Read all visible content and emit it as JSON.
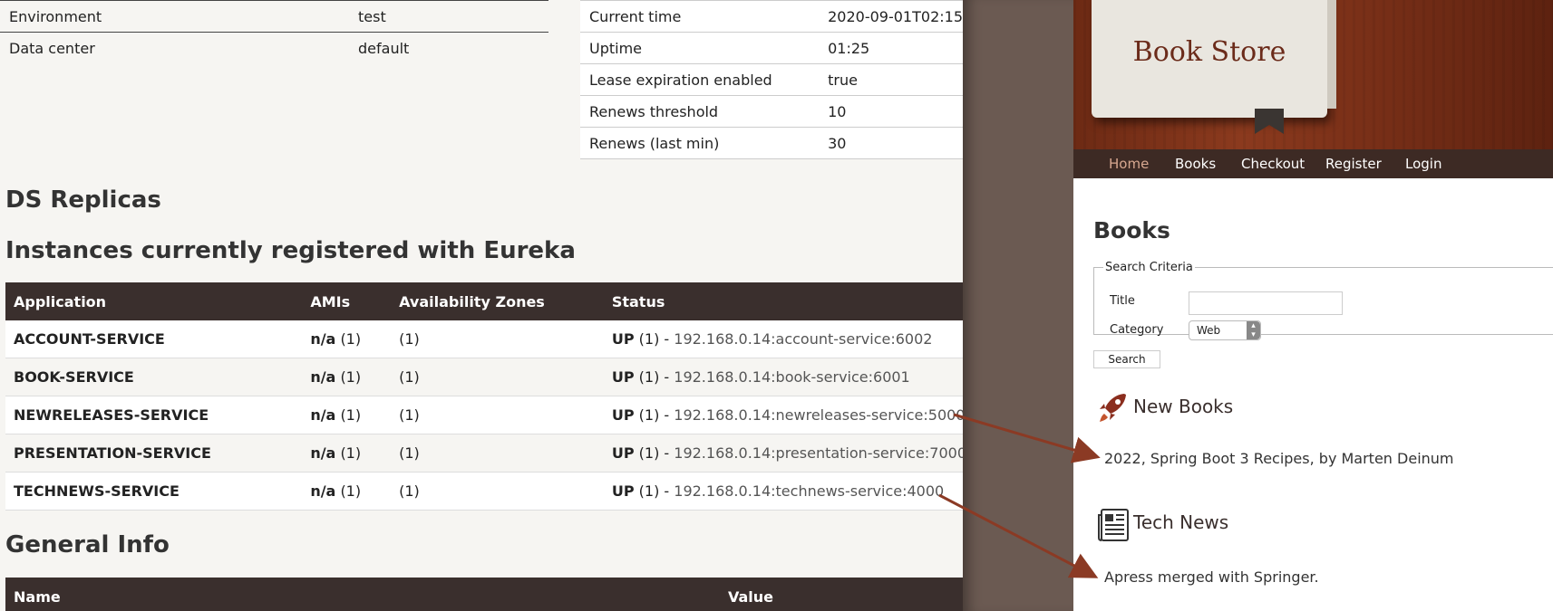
{
  "eureka": {
    "env_rows": [
      {
        "key": "Environment",
        "value": "test"
      },
      {
        "key": "Data center",
        "value": "default"
      }
    ],
    "status_rows": [
      {
        "key": "Current time",
        "value": "2020-09-01T02:15"
      },
      {
        "key": "Uptime",
        "value": "01:25"
      },
      {
        "key": "Lease expiration enabled",
        "value": "true"
      },
      {
        "key": "Renews threshold",
        "value": "10"
      },
      {
        "key": "Renews (last min)",
        "value": "30"
      }
    ],
    "ds_replicas_heading": "DS Replicas",
    "instances_heading": "Instances currently registered with Eureka",
    "instances_columns": [
      "Application",
      "AMIs",
      "Availability Zones",
      "Status"
    ],
    "instances": [
      {
        "app": "ACCOUNT-SERVICE",
        "ami_label": "n/a",
        "ami_count": "(1)",
        "zones": "(1)",
        "status": "UP",
        "status_count": "(1) -",
        "url": "192.168.0.14:account-service:6002"
      },
      {
        "app": "BOOK-SERVICE",
        "ami_label": "n/a",
        "ami_count": "(1)",
        "zones": "(1)",
        "status": "UP",
        "status_count": "(1) -",
        "url": "192.168.0.14:book-service:6001"
      },
      {
        "app": "NEWRELEASES-SERVICE",
        "ami_label": "n/a",
        "ami_count": "(1)",
        "zones": "(1)",
        "status": "UP",
        "status_count": "(1) -",
        "url": "192.168.0.14:newreleases-service:5000"
      },
      {
        "app": "PRESENTATION-SERVICE",
        "ami_label": "n/a",
        "ami_count": "(1)",
        "zones": "(1)",
        "status": "UP",
        "status_count": "(1) -",
        "url": "192.168.0.14:presentation-service:7000"
      },
      {
        "app": "TECHNEWS-SERVICE",
        "ami_label": "n/a",
        "ami_count": "(1)",
        "zones": "(1)",
        "status": "UP",
        "status_count": "(1) -",
        "url": "192.168.0.14:technews-service:4000"
      }
    ],
    "general_info_heading": "General Info",
    "general_info_columns": [
      "Name",
      "Value"
    ]
  },
  "store": {
    "banner_title": "Book Store",
    "nav": [
      "Home",
      "Books",
      "Checkout",
      "Register",
      "Login"
    ],
    "page_title": "Books",
    "search": {
      "legend": "Search Criteria",
      "title_label": "Title",
      "title_value": "",
      "category_label": "Category",
      "category_value": "Web",
      "button_label": "Search"
    },
    "new_books_heading": "New Books",
    "new_book_item": "2022, Spring Boot 3 Recipes, by Marten Deinum",
    "tech_news_heading": "Tech News",
    "tech_news_item": "Apress merged with Springer."
  },
  "colors": {
    "header_dark": "#3a2f2d",
    "nav_active": "#d8a890",
    "arrow": "#8b3a24"
  }
}
